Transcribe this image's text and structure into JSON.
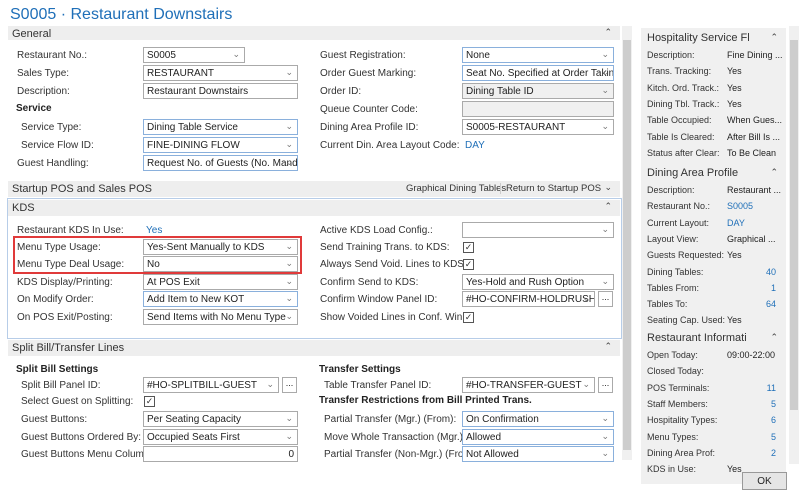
{
  "title": "S0005 · Restaurant Downstairs",
  "sections": {
    "general": {
      "label": "General",
      "left": [
        {
          "label": "Restaurant No.:",
          "value": "S0005",
          "type": "dropdown",
          "short": true
        },
        {
          "label": "Sales Type:",
          "value": "RESTAURANT",
          "type": "dropdown"
        },
        {
          "label": "Description:",
          "value": "Restaurant Downstairs",
          "type": "text"
        },
        {
          "label": "Service",
          "type": "subheader"
        },
        {
          "label": "Service Type:",
          "value": "Dining Table Service",
          "type": "dropdown",
          "indent": true,
          "focus": true
        },
        {
          "label": "Service Flow ID:",
          "value": "FINE-DINING FLOW",
          "type": "dropdown",
          "indent": true,
          "focus": true
        },
        {
          "label": "Guest Handling:",
          "value": "Request No. of Guests (No. Mandat...",
          "type": "dropdown",
          "focus": true
        }
      ],
      "right": [
        {
          "label": "Guest Registration:",
          "value": "None",
          "type": "dropdown",
          "focus": true
        },
        {
          "label": "Order Guest Marking:",
          "value": "Seat No. Specified at Order Taking",
          "type": "dropdown",
          "focus": true
        },
        {
          "label": "Order ID:",
          "value": "Dining Table ID",
          "type": "dropdown",
          "readonly": true
        },
        {
          "label": "Queue Counter Code:",
          "value": "",
          "type": "text",
          "readonly": true
        },
        {
          "label": "Dining Area Profile ID:",
          "value": "S0005-RESTAURANT",
          "type": "dropdown"
        },
        {
          "label": "Current Din. Area Layout Code:",
          "value": "DAY",
          "type": "link"
        }
      ]
    },
    "startup": {
      "label": "Startup POS and Sales POS",
      "actions": [
        "Graphical Dining Tables",
        "Return to Startup POS"
      ]
    },
    "kds": {
      "label": "KDS",
      "left": [
        {
          "label": "Restaurant KDS In Use:",
          "value": "Yes",
          "type": "link"
        },
        {
          "label": "Menu Type Usage:",
          "value": "Yes-Sent Manually to KDS",
          "type": "dropdown"
        },
        {
          "label": "Menu Type Deal Usage:",
          "value": "No",
          "type": "dropdown"
        },
        {
          "label": "KDS Display/Printing:",
          "value": "At POS Exit",
          "type": "dropdown"
        },
        {
          "label": "On Modify Order:",
          "value": "Add Item to New KOT",
          "type": "dropdown",
          "focus": true
        },
        {
          "label": "On POS Exit/Posting:",
          "value": "Send Items with No Menu Type",
          "type": "dropdown"
        }
      ],
      "right": [
        {
          "label": "Active KDS Load Config.:",
          "value": "",
          "type": "dropdown"
        },
        {
          "label": "Send Training Trans. to KDS:",
          "checked": true,
          "type": "checkbox"
        },
        {
          "label": "Always Send Void. Lines to KDS:",
          "checked": true,
          "type": "checkbox"
        },
        {
          "label": "Confirm Send to KDS:",
          "value": "Yes-Hold and Rush Option",
          "type": "dropdown"
        },
        {
          "label": "Confirm Window Panel ID:",
          "value": "#HO-CONFIRM-HOLDRUSH",
          "type": "lookup",
          "button": "..."
        },
        {
          "label": "Show Voided Lines in Conf. Win:",
          "checked": true,
          "type": "checkbox"
        }
      ]
    },
    "split": {
      "label": "Split Bill/Transfer Lines",
      "left": [
        {
          "label": "Split Bill Settings",
          "type": "subheader"
        },
        {
          "label": "Split Bill Panel ID:",
          "value": "#HO-SPLITBILL-GUEST",
          "type": "lookup",
          "button": "...",
          "indent": true
        },
        {
          "label": "Select Guest on Splitting:",
          "checked": true,
          "type": "checkbox",
          "indent": true
        },
        {
          "label": "Guest Buttons:",
          "value": "Per Seating Capacity",
          "type": "dropdown",
          "indent": true
        },
        {
          "label": "Guest Buttons Ordered By:",
          "value": "Occupied Seats First",
          "type": "dropdown",
          "indent": true
        },
        {
          "label": "Guest Buttons Menu Columns:",
          "value": "0",
          "type": "number",
          "indent": true
        }
      ],
      "right": [
        {
          "label": "Transfer Settings",
          "type": "subheader"
        },
        {
          "label": "Table Transfer Panel ID:",
          "value": "#HO-TRANSFER-GUEST",
          "type": "lookup",
          "button": "...",
          "indent": true
        },
        {
          "label": "Transfer Restrictions from Bill Printed Trans.",
          "type": "subheader"
        },
        {
          "label": "Partial Transfer (Mgr.) (From):",
          "value": "On Confirmation",
          "type": "dropdown",
          "indent": true,
          "focus": true
        },
        {
          "label": "Move Whole Transaction (Mgr.):",
          "value": "Allowed",
          "type": "dropdown",
          "indent": true,
          "focus": true
        },
        {
          "label": "Partial Transfer (Non-Mgr.) (From):",
          "value": "Not Allowed",
          "type": "dropdown",
          "indent": true,
          "focus": true
        }
      ]
    }
  },
  "factboxes": [
    {
      "title": "Hospitality Service Fl",
      "rows": [
        {
          "k": "Description:",
          "v": "Fine Dining ..."
        },
        {
          "k": "Trans. Tracking:",
          "v": "Yes"
        },
        {
          "k": "Kitch. Ord. Track.:",
          "v": "Yes"
        },
        {
          "k": "Dining Tbl. Track.:",
          "v": "Yes"
        },
        {
          "k": "Table Occupied:",
          "v": "When Gues..."
        },
        {
          "k": "Table Is Cleared:",
          "v": "After Bill Is ..."
        },
        {
          "k": "Status after Clear:",
          "v": "To Be Clean"
        }
      ]
    },
    {
      "title": "Dining Area Profile",
      "rows": [
        {
          "k": "Description:",
          "v": "Restaurant ..."
        },
        {
          "k": "Restaurant No.:",
          "v": "S0005",
          "link": true
        },
        {
          "k": "Current Layout:",
          "v": "DAY",
          "link": true
        },
        {
          "k": "Layout View:",
          "v": "Graphical ..."
        },
        {
          "k": "Guests Requested:",
          "v": "Yes"
        },
        {
          "k": "Dining Tables:",
          "v": "40",
          "link": true,
          "right": true
        },
        {
          "k": "Tables From:",
          "v": "1",
          "link": true,
          "right": true
        },
        {
          "k": "Tables To:",
          "v": "64",
          "link": true,
          "right": true
        },
        {
          "k": "Seating Cap. Used:",
          "v": "Yes"
        }
      ]
    },
    {
      "title": "Restaurant Informati",
      "rows": [
        {
          "k": "Open Today:",
          "v": "09:00-22:00"
        },
        {
          "k": "Closed Today:",
          "v": ""
        },
        {
          "k": "POS Terminals:",
          "v": "11",
          "link": true,
          "right": true
        },
        {
          "k": "Staff Members:",
          "v": "5",
          "link": true,
          "right": true
        },
        {
          "k": "Hospitality Types:",
          "v": "6",
          "link": true,
          "right": true
        },
        {
          "k": "Menu Types:",
          "v": "5",
          "link": true,
          "right": true
        },
        {
          "k": "Dining Area Prof:",
          "v": "2",
          "link": true,
          "right": true
        },
        {
          "k": "KDS in Use:",
          "v": "Yes"
        }
      ]
    }
  ],
  "ok_label": "OK",
  "colors": {
    "accent": "#1f6fb8",
    "highlight": "#e03a3a"
  }
}
